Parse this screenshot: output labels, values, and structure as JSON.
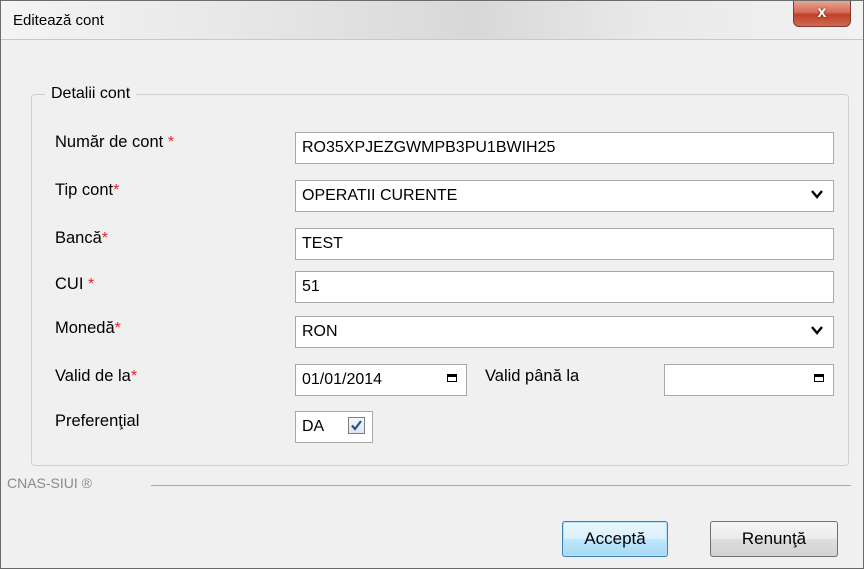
{
  "window": {
    "title": "Editează cont",
    "close_symbol": "x"
  },
  "group": {
    "legend": "Detalii cont"
  },
  "required_mark": "*",
  "fields": {
    "account_number": {
      "label": "Număr de cont",
      "value": "RO35XPJEZGWMPB3PU1BWIH25"
    },
    "account_type": {
      "label": "Tip cont",
      "value": "OPERATII CURENTE"
    },
    "bank": {
      "label": "Bancă",
      "value": "TEST"
    },
    "cui": {
      "label": "CUI",
      "value": "51"
    },
    "currency": {
      "label": "Monedă",
      "value": "RON"
    },
    "valid_from": {
      "label": "Valid de la",
      "value": "01/01/2014"
    },
    "valid_to": {
      "label": "Valid până la",
      "value": ""
    },
    "preferential": {
      "label": "Preferenţial",
      "value": "DA",
      "checked": true
    }
  },
  "footer": {
    "brand": "CNAS-SIUI ®"
  },
  "buttons": {
    "accept": "Acceptă",
    "cancel": "Renunţă"
  },
  "colors": {
    "required": "#e0242a",
    "accent": "#3c7fb1",
    "close": "#c0402a"
  },
  "icons": [
    "close-icon",
    "chevron-down-icon",
    "calendar-icon",
    "checkbox-check-icon"
  ]
}
